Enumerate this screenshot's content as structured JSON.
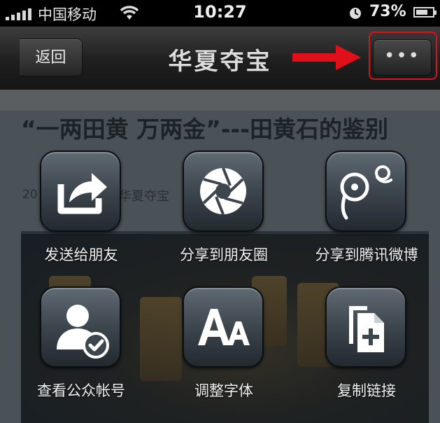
{
  "status_bar": {
    "carrier": "中国移动",
    "time": "10:27",
    "battery": "73%",
    "battery_level": 0.73,
    "icons": [
      "signal-icon",
      "wifi-icon",
      "alarm-icon",
      "battery-icon"
    ]
  },
  "nav": {
    "back_label": "返回",
    "title": "华夏夺宝",
    "more_label": "•••"
  },
  "annotation": {
    "arrow_color": "#e0101a",
    "highlight_color": "#e0101a"
  },
  "article": {
    "title": "“一两田黄 万两金”---田黄石的鉴别",
    "date": "20",
    "source": "华夏夺宝"
  },
  "share_menu": {
    "items": [
      {
        "label": "发送给朋友",
        "icon": "share-arrow-icon"
      },
      {
        "label": "分享到朋友圈",
        "icon": "camera-shutter-icon"
      },
      {
        "label": "分享到腾讯微博",
        "icon": "tencent-weibo-icon"
      },
      {
        "label": "查看公众帐号",
        "icon": "user-check-icon"
      },
      {
        "label": "调整字体",
        "icon": "font-size-icon"
      },
      {
        "label": "复制链接",
        "icon": "copy-document-icon"
      }
    ]
  }
}
